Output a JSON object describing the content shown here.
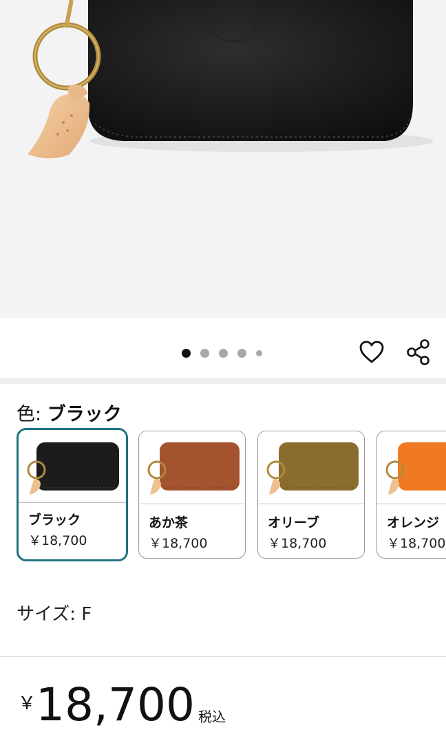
{
  "carousel": {
    "count": 5,
    "active_index": 0
  },
  "actions": {
    "wishlist_icon": "heart-outline-icon",
    "share_icon": "share-icon"
  },
  "color": {
    "label": "色:",
    "selected": "ブラック",
    "options": [
      {
        "name": "ブラック",
        "price": "￥18,700",
        "leather": "#1c1c1c"
      },
      {
        "name": "あか茶",
        "price": "￥18,700",
        "leather": "#a4532f"
      },
      {
        "name": "オリーブ",
        "price": "￥18,700",
        "leather": "#8a6d2e"
      },
      {
        "name": "オレンジ",
        "price": "￥18,700",
        "leather": "#f07a22"
      }
    ],
    "selected_border": "#1e7380"
  },
  "size": {
    "text": "サイズ: F"
  },
  "price": {
    "currency": "￥",
    "amount": "18,700",
    "tax": "税込"
  }
}
